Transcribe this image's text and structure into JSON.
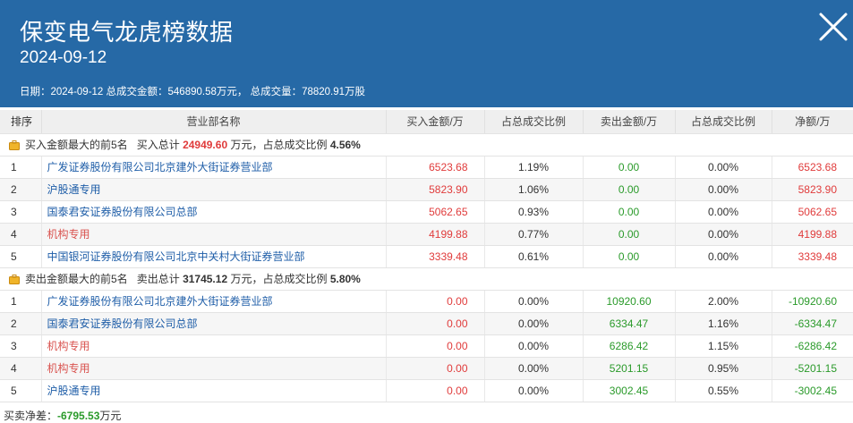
{
  "header": {
    "title": "保变电气龙虎榜数据",
    "date": "2024-09-12",
    "summary": "日期：2024-09-12 总成交金额：546890.58万元， 总成交量：78820.91万股",
    "close_icon": "close-icon",
    "bg_color": "#2669a6"
  },
  "table": {
    "columns": [
      "排序",
      "营业部名称",
      "买入金额/万",
      "占总成交比例",
      "卖出金额/万",
      "占总成交比例",
      "净额/万"
    ]
  },
  "buy_section": {
    "icon": "briefcase-icon",
    "label": "买入金额最大的前5名",
    "total_label": "买入总计",
    "total_value": "24949.60",
    "unit_text": "万元，占总成交比例",
    "ratio": "4.56%",
    "rows": [
      {
        "rank": "1",
        "name": "广发证券股份有限公司北京建外大街证券营业部",
        "buy": "6523.68",
        "buy_ratio": "1.19%",
        "sell": "0.00",
        "sell_ratio": "0.00%",
        "net": "6523.68"
      },
      {
        "rank": "2",
        "name": "沪股通专用",
        "buy": "5823.90",
        "buy_ratio": "1.06%",
        "sell": "0.00",
        "sell_ratio": "0.00%",
        "net": "5823.90"
      },
      {
        "rank": "3",
        "name": "国泰君安证券股份有限公司总部",
        "buy": "5062.65",
        "buy_ratio": "0.93%",
        "sell": "0.00",
        "sell_ratio": "0.00%",
        "net": "5062.65"
      },
      {
        "rank": "4",
        "name": "机构专用",
        "buy": "4199.88",
        "buy_ratio": "0.77%",
        "sell": "0.00",
        "sell_ratio": "0.00%",
        "net": "4199.88"
      },
      {
        "rank": "5",
        "name": "中国银河证券股份有限公司北京中关村大街证券营业部",
        "buy": "3339.48",
        "buy_ratio": "0.61%",
        "sell": "0.00",
        "sell_ratio": "0.00%",
        "net": "3339.48"
      }
    ]
  },
  "sell_section": {
    "icon": "briefcase-icon",
    "label": "卖出金额最大的前5名",
    "total_label": "卖出总计",
    "total_value": "31745.12",
    "unit_text": "万元，占总成交比例",
    "ratio": "5.80%",
    "rows": [
      {
        "rank": "1",
        "name": "广发证券股份有限公司北京建外大街证券营业部",
        "buy": "0.00",
        "buy_ratio": "0.00%",
        "sell": "10920.60",
        "sell_ratio": "2.00%",
        "net": "-10920.60"
      },
      {
        "rank": "2",
        "name": "国泰君安证券股份有限公司总部",
        "buy": "0.00",
        "buy_ratio": "0.00%",
        "sell": "6334.47",
        "sell_ratio": "1.16%",
        "net": "-6334.47"
      },
      {
        "rank": "3",
        "name": "机构专用",
        "buy": "0.00",
        "buy_ratio": "0.00%",
        "sell": "6286.42",
        "sell_ratio": "1.15%",
        "net": "-6286.42"
      },
      {
        "rank": "4",
        "name": "机构专用",
        "buy": "0.00",
        "buy_ratio": "0.00%",
        "sell": "5201.15",
        "sell_ratio": "0.95%",
        "net": "-5201.15"
      },
      {
        "rank": "5",
        "name": "沪股通专用",
        "buy": "0.00",
        "buy_ratio": "0.00%",
        "sell": "3002.45",
        "sell_ratio": "0.55%",
        "net": "-3002.45"
      }
    ]
  },
  "footer": {
    "label": "买卖净差：",
    "value": "-6795.53",
    "unit": "万元"
  },
  "colors": {
    "positive": "#e03b3b",
    "negative": "#2a9a2a",
    "link": "#1f5ea8",
    "institution": "#d9534f"
  }
}
